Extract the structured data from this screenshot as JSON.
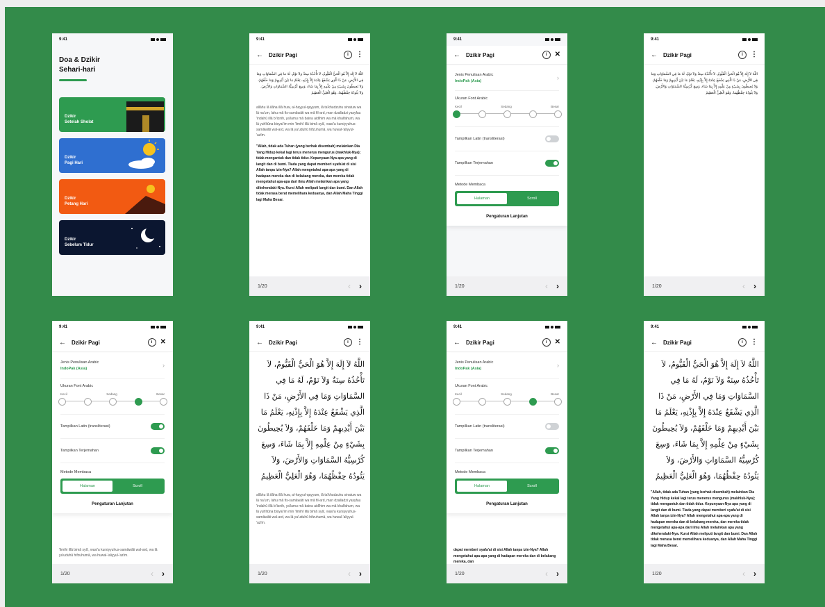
{
  "status": {
    "time": "9:41"
  },
  "home": {
    "title_line1": "Doa & Dzikir",
    "title_line2": "Sehari-hari",
    "cards": [
      {
        "line1": "Dzikir",
        "line2": "Setelah Sholat",
        "color": "#2e9b50",
        "icon": "kaaba-icon"
      },
      {
        "line1": "Dzikir",
        "line2": "Pagi Hari",
        "color": "#2f6fd0",
        "icon": "sunrise-icon"
      },
      {
        "line1": "Dzikir",
        "line2": "Petang Hari",
        "color": "#f25a12",
        "icon": "sunset-icon"
      },
      {
        "line1": "Dzikir",
        "line2": "Sebelum Tidur",
        "color": "#0b1630",
        "icon": "moon-icon"
      }
    ]
  },
  "reader": {
    "title": "Dzikir Pagi",
    "page_indicator": "1/20",
    "arabic_small": "اللَّهُ لاَ إِلَهَ إِلاَّ هُوَ الْحَيُّ الْقَيُّومُ، لاَ تَأْخُذُهُ سِنَةٌ وَلاَ نَوْمٌ، لَهُ مَا فِي السَّمَاوَاتِ وَمَا فِي الأَرْضِ، مَنْ ذَا الَّذِي يَشْفَعُ عِنْدَهُ إِلاَّ بِإِذْنِهِ، يَعْلَمُ مَا بَيْنَ أَيْدِيهِمْ وَمَا خَلْفَهُمْ، وَلاَ يُحِيطُونَ بِشَيْءٍ مِنْ عِلْمِهِ إِلاَّ بِمَا شَاءَ، وَسِعَ كُرْسِيُّهُ السَّمَاوَاتِ وَالأَرْضَ، وَلاَ يَئُودُهُ حِفْظُهُمَا، وَهُوَ الْعَلِيُّ الْعَظِيمُ",
    "arabic_large": "اللَّهُ لاَ إِلَهَ إِلاَّ هُوَ الْحَيُّ الْقَيُّومُ، لاَ تَأْخُذُهُ سِنَةٌ وَلاَ نَوْمٌ، لَهُ مَا فِي السَّمَاوَاتِ وَمَا فِي الأَرْضِ، مَنْ ذَا الَّذِي يَشْفَعُ عِنْدَهُ إِلاَّ بِإِذْنِهِ، يَعْلَمُ مَا بَيْنَ أَيْدِيهِمْ وَمَا خَلْفَهُمْ، وَلاَ يُحِيطُونَ بِشَيْءٍ مِنْ عِلْمِهِ إِلاَّ بِمَا شَاءَ، وَسِعَ كُرْسِيُّهُ السَّمَاوَاتِ وَالأَرْضَ، وَلاَ يَئُودُهُ حِفْظُهُمَا، وَهُوَ الْعَلِيُّ الْعَظِيمُ",
    "latin": "allâhu lâ ilâha illâ huw, al-hayyul-qayyum, lâ ta'khudzuhu sinatuw wa lâ na'um, lahu mâ fis-samâwâti wa mâ fil-ard, man dzalladzi yasyfau 'indahû illâ bi'iznih, ya'lamu mâ baina aidîhim wa mâ khalfahum, wa lâ yuhîtûna bisyai'im min 'ilmihî illâ bimâ syâ', wasi'a kursiyyuhus-samâwâti wal-ard, wa lâ ya'uduhû hifzuhumâ, wa huwal-'aliyyul-'azîm.",
    "translation": "\"Allah, tidak ada Tuhan (yang berhak disembah) melainkan Dia Yang Hidup kekal lagi terus menerus mengurus (makhluk-Nya); tidak mengantuk dan tidak tidur. Kepunyaan-Nya apa yang di langit dan di bumi. Tiada yang dapat memberi syafa'at di sisi Allah tanpa izin-Nya? Allah mengetahui apa-apa yang di hadapan mereka dan di belakang mereka, dan mereka tidak mengetahui apa-apa dari ilmu Allah melainkan apa yang dikehendaki-Nya. Kursi Allah meliputi langit dan bumi. Dan Allah tidak merasa berat memelihara keduanya, dan Allah Maha Tinggi lagi Maha Besar.",
    "translation_tail": "dapat memberi syafa'at di sisi Allah tanpa izin-Nya? Allah mengetahui apa-apa yang di hadapan mereka dan di belakang mereka, dan",
    "latin_tail": "'ilmihi illâ bimâ syâ', wasi'a kursiyyuhus-samâwâti wal-ard, wa lâ ya'uduhû hifzuhumâ, wa huwal-'aliyyul-'azîm."
  },
  "settings": {
    "arabic_script_label": "Jenis Penulisan Arabic",
    "arabic_script_value": "IndoPak (Asia)",
    "font_size_label": "Ukuran Font Arabic",
    "size_small": "Kecil",
    "size_medium": "Sedang",
    "size_large": "Besar",
    "latin_label": "Tampilkan Latin (transliterasi)",
    "translation_label": "Tampilkan Terjemahan",
    "read_mode_label": "Metode Membaca",
    "mode_page": "Halaman",
    "mode_scroll": "Scroll",
    "advanced": "Pengaturan Lanjutan"
  },
  "settings_states": [
    {
      "font_level": 0,
      "latin_on": false,
      "translation_on": true
    },
    {
      "font_level": 3,
      "latin_on": true,
      "translation_on": true
    },
    {
      "font_level": 3,
      "latin_on": false,
      "translation_on": true
    }
  ],
  "colors": {
    "background": "#338b4a",
    "accent": "#2e9b50"
  }
}
